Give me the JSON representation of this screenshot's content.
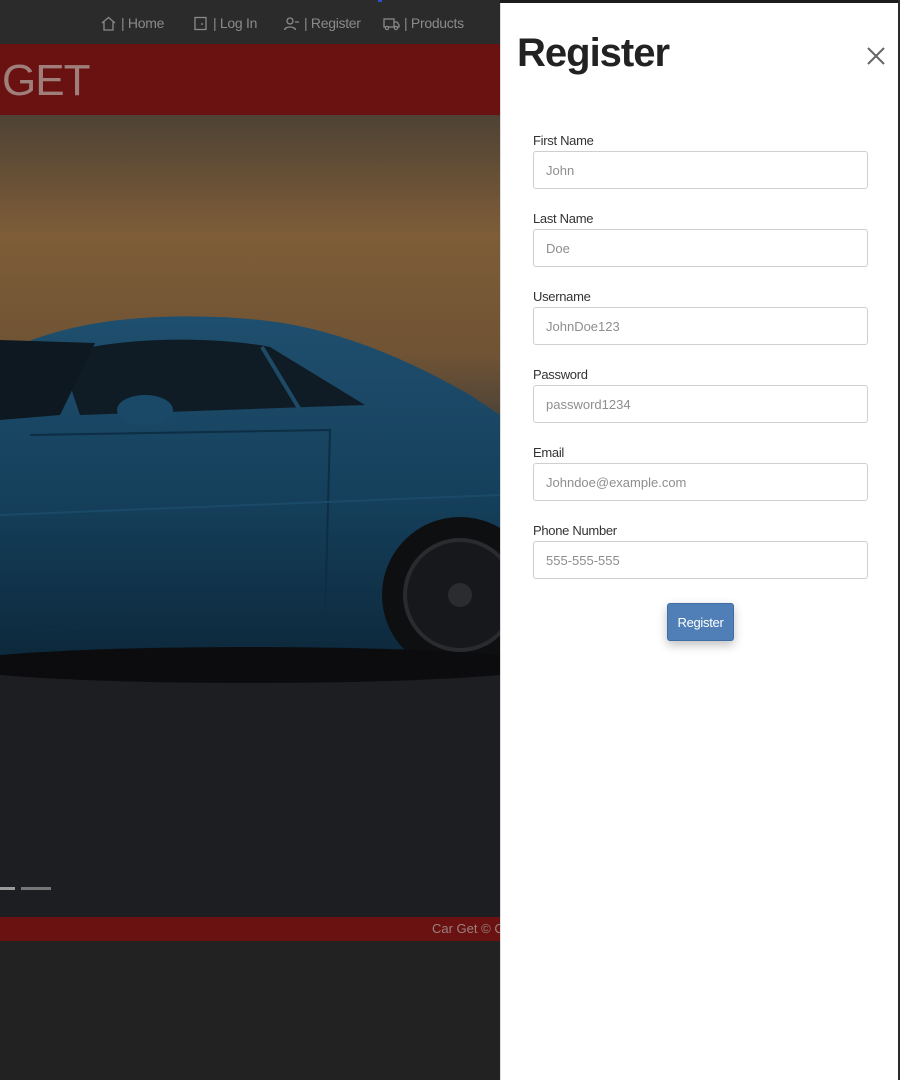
{
  "nav": {
    "items": [
      {
        "label": "| Home",
        "icon": "home-icon"
      },
      {
        "label": "| Log In",
        "icon": "login-icon"
      },
      {
        "label": "| Register",
        "icon": "user-add-icon"
      },
      {
        "label": "| Products",
        "icon": "truck-icon"
      }
    ]
  },
  "site": {
    "title": "GET",
    "footer": "Car Get © Co"
  },
  "modal": {
    "title": "Register",
    "fields": [
      {
        "label": "First Name",
        "placeholder": "John"
      },
      {
        "label": "Last Name",
        "placeholder": "Doe"
      },
      {
        "label": "Username",
        "placeholder": "JohnDoe123"
      },
      {
        "label": "Password",
        "placeholder": "password1234"
      },
      {
        "label": "Email",
        "placeholder": "Johndoe@example.com"
      },
      {
        "label": "Phone Number",
        "placeholder": "555-555-555"
      }
    ],
    "submit_label": "Register"
  },
  "colors": {
    "brand_red": "#6a1212",
    "button_blue": "#4f7fb6",
    "nav_bg": "#2b2b2b"
  }
}
